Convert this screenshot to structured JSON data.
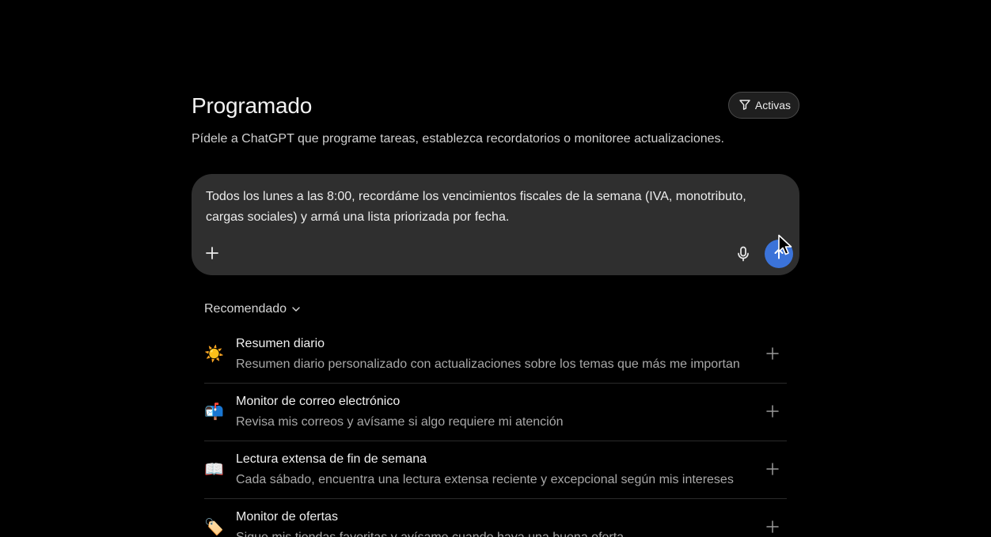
{
  "header": {
    "title": "Programado",
    "filter_label": "Activas",
    "subtitle": "Pídele a ChatGPT que programe tareas, establezca recordatorios o monitoree actualizaciones."
  },
  "composer": {
    "value": "Todos los lunes a las 8:00, recordáme los vencimientos fiscales de la semana (IVA, monotributo, cargas sociales) y armá una lista priorizada por fecha.",
    "send_color": "#3b73d9"
  },
  "recommended": {
    "label": "Recomendado",
    "items": [
      {
        "emoji": "☀️",
        "title": "Resumen diario",
        "description": "Resumen diario personalizado con actualizaciones sobre los temas que más me importan"
      },
      {
        "emoji": "📬",
        "title": "Monitor de correo electrónico",
        "description": "Revisa mis correos y avísame si algo requiere mi atención"
      },
      {
        "emoji": "📖",
        "title": "Lectura extensa de fin de semana",
        "description": "Cada sábado, encuentra una lectura extensa reciente y excepcional según mis intereses"
      },
      {
        "emoji": "🏷️",
        "title": "Monitor de ofertas",
        "description": "Sigue mis tiendas favoritas y avísame cuando haya una buena oferta"
      }
    ]
  }
}
